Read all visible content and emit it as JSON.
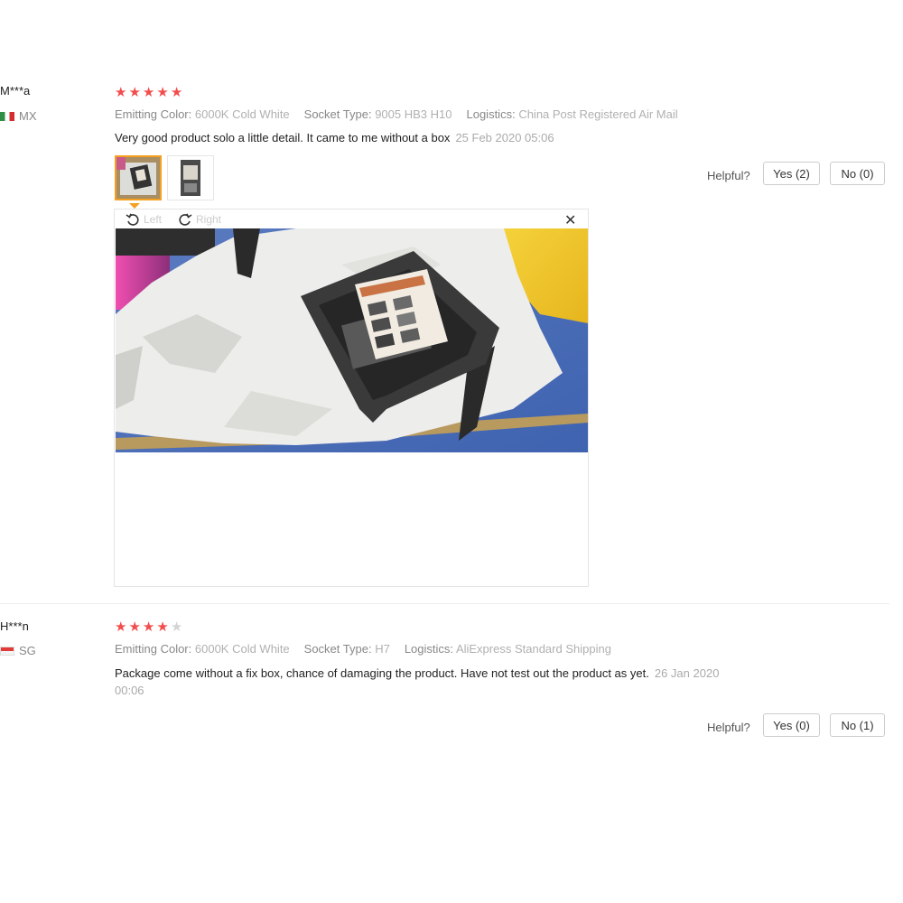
{
  "reviews": [
    {
      "user": "M***a",
      "country": "MX",
      "rating": 5,
      "stars_max": 5,
      "attrs": [
        {
          "label": "Emitting Color:",
          "value": "6000K Cold White"
        },
        {
          "label": "Socket Type:",
          "value": "9005 HB3 H10"
        },
        {
          "label": "Logistics:",
          "value": "China Post Registered Air Mail"
        }
      ],
      "text": "Very good product solo a little detail. It came to me without a box",
      "date": "25 Feb 2020 05:06",
      "helpful_label": "Helpful?",
      "yes_label": "Yes (2)",
      "no_label": "No (0)"
    },
    {
      "user": "H***n",
      "country": "SG",
      "rating": 4,
      "stars_max": 5,
      "attrs": [
        {
          "label": "Emitting Color:",
          "value": "6000K Cold White"
        },
        {
          "label": "Socket Type:",
          "value": "H7"
        },
        {
          "label": "Logistics:",
          "value": "AliExpress Standard Shipping"
        }
      ],
      "text": "Package come without a fix box, chance of damaging the product. Have not test out the product as yet.",
      "date_line1": "26 Jan 2020",
      "date_line2": "00:06",
      "helpful_label": "Helpful?",
      "yes_label": "Yes (0)",
      "no_label": "No (1)"
    }
  ],
  "viewer": {
    "left_label": "Left",
    "right_label": "Right",
    "close_icon": "close-icon",
    "rotate_left_icon": "rotate-left-icon",
    "rotate_right_icon": "rotate-right-icon"
  },
  "colors": {
    "star_on": "#f24d4d",
    "star_off": "#d4d4d4",
    "thumb_active_border": "#f5a020"
  }
}
